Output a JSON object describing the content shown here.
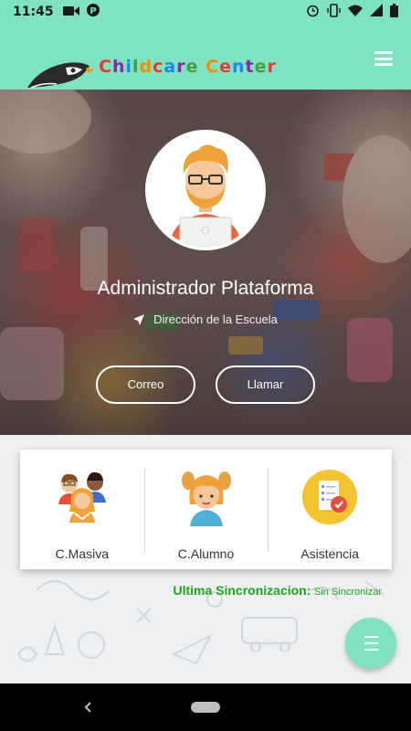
{
  "status_bar": {
    "time": "11:45",
    "left_icons": [
      "videocam-icon",
      "parking-icon"
    ],
    "right_icons": [
      "alarm-icon",
      "vibrate-icon",
      "wifi-icon",
      "signal-icon",
      "battery-icon"
    ]
  },
  "app_bar": {
    "logo_text": "Childcare Center",
    "logo_letters": [
      {
        "ch": "C",
        "color": "#e53935"
      },
      {
        "ch": "h",
        "color": "#8e24aa"
      },
      {
        "ch": "i",
        "color": "#1e88e5"
      },
      {
        "ch": "l",
        "color": "#43a047"
      },
      {
        "ch": "d",
        "color": "#fb8c00"
      },
      {
        "ch": "c",
        "color": "#e53935"
      },
      {
        "ch": "a",
        "color": "#1e88e5"
      },
      {
        "ch": "r",
        "color": "#8e24aa"
      },
      {
        "ch": "e",
        "color": "#43a047"
      },
      {
        "ch": " ",
        "color": "#000000"
      },
      {
        "ch": "C",
        "color": "#fb8c00"
      },
      {
        "ch": "e",
        "color": "#e53935"
      },
      {
        "ch": "n",
        "color": "#1e88e5"
      },
      {
        "ch": "t",
        "color": "#8e24aa"
      },
      {
        "ch": "e",
        "color": "#43a047"
      },
      {
        "ch": "r",
        "color": "#e53935"
      }
    ],
    "menu_icon": "hamburger-icon"
  },
  "profile": {
    "name": "Administrador Plataforma",
    "address": "Dirección de la Escuela",
    "address_icon": "navigation-arrow-icon",
    "buttons": {
      "email": "Correo",
      "call": "Llamar"
    }
  },
  "shortcuts": [
    {
      "label": "C.Masiva",
      "icon": "group-children-icon"
    },
    {
      "label": "C.Alumno",
      "icon": "girl-student-icon"
    },
    {
      "label": "Asistencia",
      "icon": "attendance-checklist-icon"
    }
  ],
  "sync": {
    "label": "Ultima Sincronizacion:",
    "value": "Sin Sincronizar"
  },
  "colors": {
    "accent": "#7fe3c3",
    "sync_text": "#1aa51a"
  },
  "fab": {
    "icon": "list-menu-icon"
  }
}
